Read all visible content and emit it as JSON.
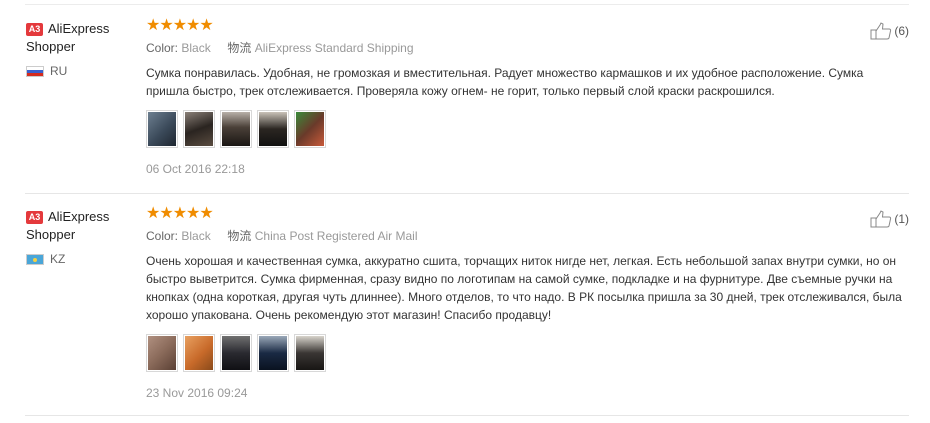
{
  "reviews": [
    {
      "level": "A3",
      "user": "AliExpress Shopper",
      "country": "RU",
      "rating": "★★★★★",
      "color_label": "Color:",
      "color_value": "Black",
      "shipping_label": "物流",
      "shipping_value": "AliExpress Standard Shipping",
      "text": "Сумка понравилась. Удобная, не громозкая и вместительная. Радует множество кармашков и их удобное расположение. Сумка пришла быстро, трек отслеживается. Проверяла кожу огнем- не горит, только первый слой краски раскрошился.",
      "date": "06 Oct 2016 22:18",
      "likes": "(6)",
      "thumb_colors": [
        "#3b4a5a",
        "#2a2420",
        "#4a4038",
        "#2b2622",
        "#6a3a2a"
      ]
    },
    {
      "level": "A3",
      "user": "AliExpress Shopper",
      "country": "KZ",
      "rating": "★★★★★",
      "color_label": "Color:",
      "color_value": "Black",
      "shipping_label": "物流",
      "shipping_value": "China Post Registered Air Mail",
      "text": "Очень хорошая и качественная сумка, аккуратно сшита, торчащих ниток нигде нет, легкая. Есть небольшой запах внутри сумки, но он быстро выветрится. Сумка фирменная, сразу видно по логотипам на самой сумке, подкладке и на фурнитуре. Две съемные ручки на кнопках (одна короткая, другая чуть длиннее). Много отделов, то что надо. В РК посылка пришла за 30 дней, трек отслеживался, была хорошо упакована. Очень рекомендую этот магазин! Спасибо продавцу!",
      "date": "23 Nov 2016 09:24",
      "likes": "(1)",
      "thumb_colors": [
        "#8a6a5a",
        "#c86a2a",
        "#2a2a30",
        "#1a2a44",
        "#3a3634"
      ]
    }
  ]
}
